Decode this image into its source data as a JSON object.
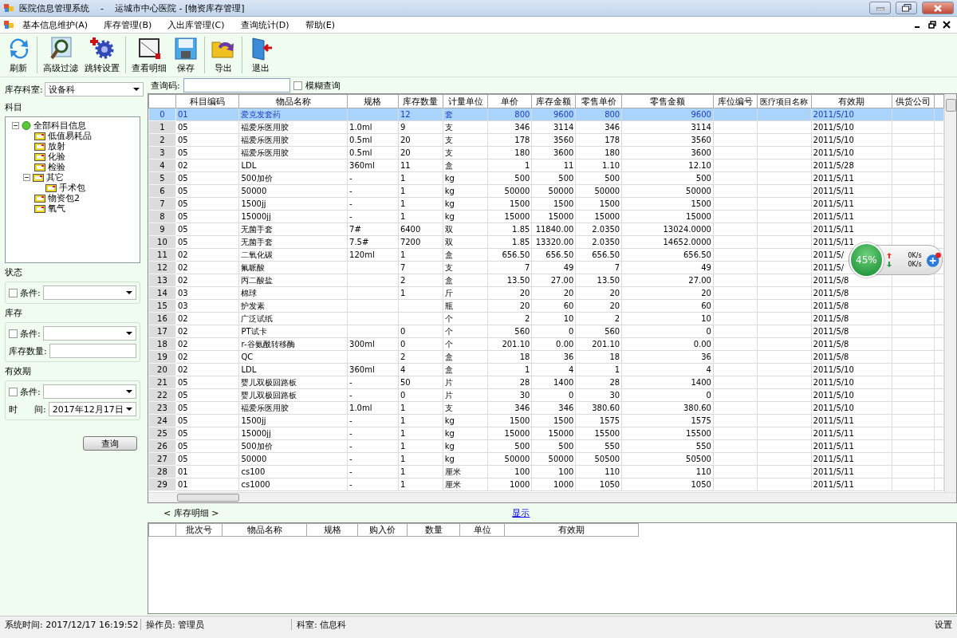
{
  "window": {
    "title": "医院信息管理系统    -    运城市中心医院 - [物资库存管理]"
  },
  "menu": [
    "基本信息维护(A)",
    "库存管理(B)",
    "入出库管理(C)",
    "查询统计(D)",
    "帮助(E)"
  ],
  "toolbar": [
    "刷新",
    "高级过滤",
    "跳转设置",
    "查看明细",
    "保存",
    "导出",
    "退出"
  ],
  "filters": {
    "department": {
      "label": "库存科室:",
      "value": "设备科"
    },
    "tree": {
      "title": "科目",
      "items": [
        {
          "label": "全部科目信息",
          "expanded": true,
          "children": [
            {
              "label": "低值易耗品"
            },
            {
              "label": "放射"
            },
            {
              "label": "化验"
            },
            {
              "label": "检验"
            },
            {
              "label": "其它",
              "expanded": true,
              "children": [
                {
                  "label": "手术包"
                }
              ]
            },
            {
              "label": "物资包2"
            },
            {
              "label": "氧气"
            }
          ]
        }
      ]
    },
    "groups": [
      {
        "title": "状态",
        "rows": [
          {
            "kind": "check",
            "label": "条件:",
            "checked": false
          }
        ]
      },
      {
        "title": "库存",
        "rows": [
          {
            "kind": "check",
            "label": "条件:",
            "checked": false
          },
          {
            "kind": "input",
            "label": "库存数量:"
          }
        ]
      },
      {
        "title": "有效期",
        "rows": [
          {
            "kind": "check",
            "label": "条件:",
            "checked": false
          },
          {
            "kind": "select",
            "label": "时      间:",
            "value": "2017年12月17日"
          }
        ]
      }
    ],
    "search_button": "查询"
  },
  "query": {
    "label": "查询码:",
    "fuzzy": {
      "label": "模糊查询",
      "checked": false
    }
  },
  "grid": {
    "columns": [
      "科目编码",
      "物品名称",
      "规格",
      "库存数量",
      "计量单位",
      "单价",
      "库存金额",
      "零售单价",
      "零售金额",
      "库位编号",
      "医疗项目名称",
      "有效期",
      "供货公司"
    ],
    "rows": [
      {
        "index": "0",
        "selected": true,
        "cells": [
          "01",
          "爱克发套药",
          null,
          "12",
          "套",
          "800",
          "9600",
          "800",
          "9600",
          null,
          null,
          "2011/5/10",
          null
        ]
      },
      {
        "index": "1",
        "selected": false,
        "cells": [
          "05",
          "福爱乐医用胶",
          "1.0ml",
          "9",
          "支",
          "346",
          "3114",
          "346",
          "3114",
          null,
          null,
          "2011/5/10",
          null
        ]
      },
      {
        "index": "2",
        "selected": false,
        "cells": [
          "05",
          "福爱乐医用胶",
          "0.5ml",
          "20",
          "支",
          "178",
          "3560",
          "178",
          "3560",
          null,
          null,
          "2011/5/10",
          null
        ]
      },
      {
        "index": "3",
        "selected": false,
        "cells": [
          "05",
          "福爱乐医用胶",
          "0.5ml",
          "20",
          "支",
          "180",
          "3600",
          "180",
          "3600",
          null,
          null,
          "2011/5/10",
          null
        ]
      },
      {
        "index": "4",
        "selected": false,
        "cells": [
          "02",
          "LDL",
          "360ml",
          "11",
          "盒",
          "1",
          "11",
          "1.10",
          "12.10",
          null,
          null,
          "2011/5/28",
          null
        ]
      },
      {
        "index": "5",
        "selected": false,
        "cells": [
          "05",
          "500加价",
          "-",
          "1",
          "kg",
          "500",
          "500",
          "500",
          "500",
          null,
          null,
          "2011/5/11",
          null
        ]
      },
      {
        "index": "6",
        "selected": false,
        "cells": [
          "05",
          "50000",
          "-",
          "1",
          "kg",
          "50000",
          "50000",
          "50000",
          "50000",
          null,
          null,
          "2011/5/11",
          null
        ]
      },
      {
        "index": "7",
        "selected": false,
        "cells": [
          "05",
          "1500jj",
          "-",
          "1",
          "kg",
          "1500",
          "1500",
          "1500",
          "1500",
          null,
          null,
          "2011/5/11",
          null
        ]
      },
      {
        "index": "8",
        "selected": false,
        "cells": [
          "05",
          "15000jj",
          "-",
          "1",
          "kg",
          "15000",
          "15000",
          "15000",
          "15000",
          null,
          null,
          "2011/5/11",
          null
        ]
      },
      {
        "index": "9",
        "selected": false,
        "cells": [
          "05",
          "无菌手套",
          "7#",
          "6400",
          "双",
          "1.85",
          "11840.00",
          "2.0350",
          "13024.0000",
          null,
          null,
          "2011/5/11",
          null
        ]
      },
      {
        "index": "10",
        "selected": false,
        "cells": [
          "05",
          "无菌手套",
          "7.5#",
          "7200",
          "双",
          "1.85",
          "13320.00",
          "2.0350",
          "14652.0000",
          null,
          null,
          "2011/5/11",
          null
        ]
      },
      {
        "index": "11",
        "selected": false,
        "cells": [
          "02",
          "二氧化碳",
          "120ml",
          "1",
          "盒",
          "656.50",
          "656.50",
          "656.50",
          "656.50",
          null,
          null,
          "2011/5/",
          null
        ]
      },
      {
        "index": "12",
        "selected": false,
        "cells": [
          "02",
          "氟哌酸",
          null,
          "7",
          "支",
          "7",
          "49",
          "7",
          "49",
          null,
          null,
          "2011/5/",
          null
        ]
      },
      {
        "index": "13",
        "selected": false,
        "cells": [
          "02",
          "丙二酸盐",
          null,
          "2",
          "盒",
          "13.50",
          "27.00",
          "13.50",
          "27.00",
          null,
          null,
          "2011/5/8",
          null
        ]
      },
      {
        "index": "14",
        "selected": false,
        "cells": [
          "03",
          "棉球",
          null,
          "1",
          "斤",
          "20",
          "20",
          "20",
          "20",
          null,
          null,
          "2011/5/8",
          null
        ]
      },
      {
        "index": "15",
        "selected": false,
        "cells": [
          "03",
          "护发素",
          null,
          null,
          "瓶",
          "20",
          "60",
          "20",
          "60",
          null,
          null,
          "2011/5/8",
          null
        ]
      },
      {
        "index": "16",
        "selected": false,
        "cells": [
          "02",
          "广泛试纸",
          null,
          null,
          "个",
          "2",
          "10",
          "2",
          "10",
          null,
          null,
          "2011/5/8",
          null
        ]
      },
      {
        "index": "17",
        "selected": false,
        "cells": [
          "02",
          "PT试卡",
          null,
          "0",
          "个",
          "560",
          "0",
          "560",
          "0",
          null,
          null,
          "2011/5/8",
          null
        ]
      },
      {
        "index": "18",
        "selected": false,
        "cells": [
          "02",
          "r-谷氨酰转移酶",
          "300ml",
          "0",
          "个",
          "201.10",
          "0.00",
          "201.10",
          "0.00",
          null,
          null,
          "2011/5/8",
          null
        ]
      },
      {
        "index": "19",
        "selected": false,
        "cells": [
          "02",
          "QC",
          null,
          "2",
          "盒",
          "18",
          "36",
          "18",
          "36",
          null,
          null,
          "2011/5/8",
          null
        ]
      },
      {
        "index": "20",
        "selected": false,
        "cells": [
          "02",
          "LDL",
          "360ml",
          "4",
          "盒",
          "1",
          "4",
          "1",
          "4",
          null,
          null,
          "2011/5/10",
          null
        ]
      },
      {
        "index": "21",
        "selected": false,
        "cells": [
          "05",
          "婴儿双极回路板",
          "-",
          "50",
          "片",
          "28",
          "1400",
          "28",
          "1400",
          null,
          null,
          "2011/5/10",
          null
        ]
      },
      {
        "index": "22",
        "selected": false,
        "cells": [
          "05",
          "婴儿双极回路板",
          "-",
          "0",
          "片",
          "30",
          "0",
          "30",
          "0",
          null,
          null,
          "2011/5/10",
          null
        ]
      },
      {
        "index": "23",
        "selected": false,
        "cells": [
          "05",
          "福爱乐医用胶",
          "1.0ml",
          "1",
          "支",
          "346",
          "346",
          "380.60",
          "380.60",
          null,
          null,
          "2011/5/10",
          null
        ]
      },
      {
        "index": "24",
        "selected": false,
        "cells": [
          "05",
          "1500jj",
          "-",
          "1",
          "kg",
          "1500",
          "1500",
          "1575",
          "1575",
          null,
          null,
          "2011/5/11",
          null
        ]
      },
      {
        "index": "25",
        "selected": false,
        "cells": [
          "05",
          "15000jj",
          "-",
          "1",
          "kg",
          "15000",
          "15000",
          "15500",
          "15500",
          null,
          null,
          "2011/5/11",
          null
        ]
      },
      {
        "index": "26",
        "selected": false,
        "cells": [
          "05",
          "500加价",
          "-",
          "1",
          "kg",
          "500",
          "500",
          "550",
          "550",
          null,
          null,
          "2011/5/11",
          null
        ]
      },
      {
        "index": "27",
        "selected": false,
        "cells": [
          "05",
          "50000",
          "-",
          "1",
          "kg",
          "50000",
          "50000",
          "50500",
          "50500",
          null,
          null,
          "2011/5/11",
          null
        ]
      },
      {
        "index": "28",
        "selected": false,
        "cells": [
          "01",
          "cs100",
          "-",
          "1",
          "厘米",
          "100",
          "100",
          "110",
          "110",
          null,
          null,
          "2011/5/11",
          null
        ]
      },
      {
        "index": "29",
        "selected": false,
        "cells": [
          "01",
          "cs1000",
          "-",
          "1",
          "厘米",
          "1000",
          "1000",
          "1050",
          "1050",
          null,
          null,
          "2011/5/11",
          null
        ]
      }
    ]
  },
  "detail": {
    "prev": "<",
    "title": "库存明细",
    "next": ">",
    "show_link": "显示",
    "columns": [
      "批次号",
      "物品名称",
      "规格",
      "购入价",
      "数量",
      "单位",
      "有效期"
    ]
  },
  "speed_widget": {
    "percent": "45%",
    "upload": "0K/s",
    "download": "0K/s"
  },
  "status_bar": [
    "系统时间: 2017/12/17 16:19:52",
    "操作员: 管理员",
    "科室: 信息科",
    "设置"
  ]
}
